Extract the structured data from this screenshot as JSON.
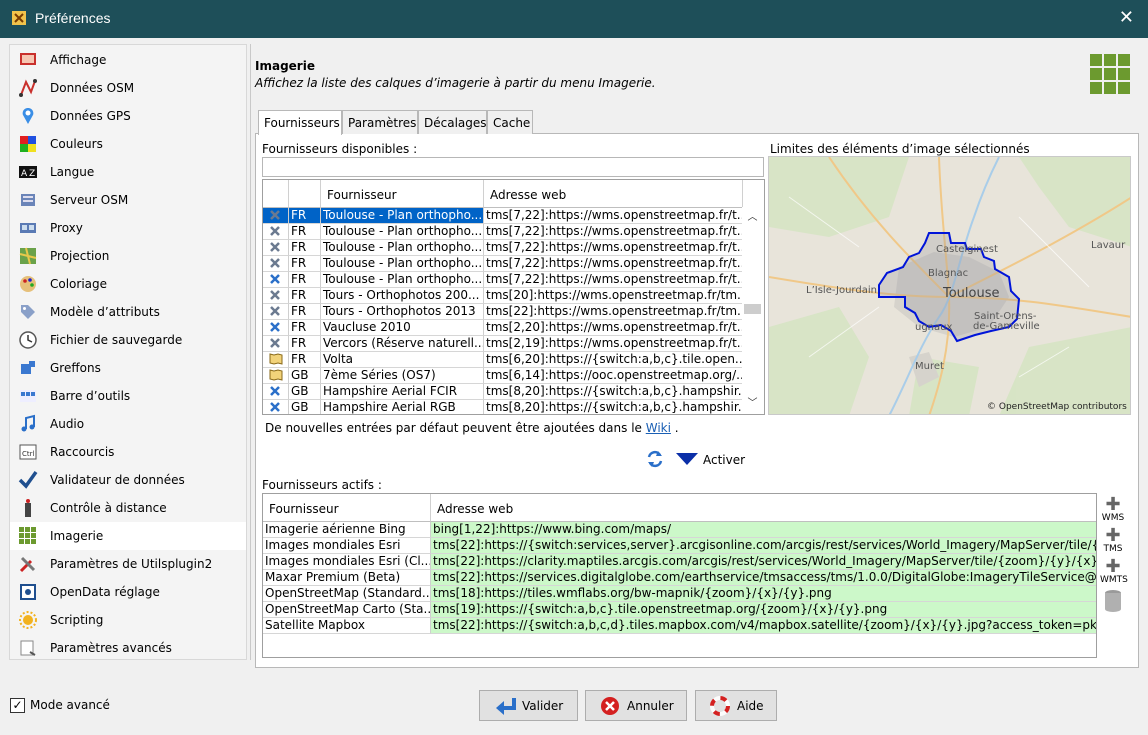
{
  "window": {
    "title": "Préférences",
    "close_label": "✕"
  },
  "sidebar": {
    "items": [
      {
        "label": "Affichage",
        "icon": "display-icon"
      },
      {
        "label": "Données OSM",
        "icon": "osm-data-icon"
      },
      {
        "label": "Données GPS",
        "icon": "gps-pin-icon"
      },
      {
        "label": "Couleurs",
        "icon": "colors-icon"
      },
      {
        "label": "Langue",
        "icon": "language-icon"
      },
      {
        "label": "Serveur OSM",
        "icon": "server-icon"
      },
      {
        "label": "Proxy",
        "icon": "proxy-icon"
      },
      {
        "label": "Projection",
        "icon": "projection-icon"
      },
      {
        "label": "Coloriage",
        "icon": "palette-icon"
      },
      {
        "label": "Modèle d’attributs",
        "icon": "tag-icon"
      },
      {
        "label": "Fichier de sauvegarde",
        "icon": "backup-clock-icon"
      },
      {
        "label": "Greffons",
        "icon": "plugin-icon"
      },
      {
        "label": "Barre d’outils",
        "icon": "toolbar-icon"
      },
      {
        "label": "Audio",
        "icon": "music-note-icon"
      },
      {
        "label": "Raccourcis",
        "icon": "keyboard-shortcut-icon"
      },
      {
        "label": "Validateur de données",
        "icon": "checkmark-icon"
      },
      {
        "label": "Contrôle à distance",
        "icon": "remote-control-icon"
      },
      {
        "label": "Imagerie",
        "icon": "imagery-grid-icon"
      },
      {
        "label": "Paramètres de Utilsplugin2",
        "icon": "tools-icon"
      },
      {
        "label": "OpenData réglage",
        "icon": "opendata-icon"
      },
      {
        "label": "Scripting",
        "icon": "sun-gear-icon"
      },
      {
        "label": "Paramètres avancés",
        "icon": "advanced-settings-icon"
      }
    ],
    "active_index": 17
  },
  "header": {
    "title": "Imagerie",
    "description": "Affichez la liste des calques d’imagerie à partir du menu Imagerie."
  },
  "tabs": [
    {
      "label": "Fournisseurs"
    },
    {
      "label": "Paramètres"
    },
    {
      "label": "Décalages"
    },
    {
      "label": "Cache"
    }
  ],
  "available": {
    "label": "Fournisseurs disponibles :",
    "filter_value": "",
    "headers": {
      "icon": "",
      "country": "",
      "name": "Fournisseur",
      "url": "Adresse web"
    },
    "rows": [
      {
        "icon": "wms-cross-icon",
        "country": "FR",
        "name": "Toulouse - Plan orthopho...",
        "url": "tms[7,22]:https://wms.openstreetmap.fr/t...",
        "selected": true
      },
      {
        "icon": "wms-cross-icon",
        "country": "FR",
        "name": "Toulouse - Plan orthopho...",
        "url": "tms[7,22]:https://wms.openstreetmap.fr/t..."
      },
      {
        "icon": "wms-cross-icon",
        "country": "FR",
        "name": "Toulouse - Plan orthopho...",
        "url": "tms[7,22]:https://wms.openstreetmap.fr/t..."
      },
      {
        "icon": "wms-cross-icon",
        "country": "FR",
        "name": "Toulouse - Plan orthopho...",
        "url": "tms[7,22]:https://wms.openstreetmap.fr/t..."
      },
      {
        "icon": "wms-cross-blue-icon",
        "country": "FR",
        "name": "Toulouse - Plan orthopho...",
        "url": "tms[7,22]:https://wms.openstreetmap.fr/t..."
      },
      {
        "icon": "wms-cross-icon",
        "country": "FR",
        "name": "Tours - Orthophotos 200...",
        "url": "tms[20]:https://wms.openstreetmap.fr/tm..."
      },
      {
        "icon": "wms-cross-icon",
        "country": "FR",
        "name": "Tours - Orthophotos 2013",
        "url": "tms[22]:https://wms.openstreetmap.fr/tm..."
      },
      {
        "icon": "wms-cross-blue-icon",
        "country": "FR",
        "name": "Vaucluse 2010",
        "url": "tms[2,20]:https://wms.openstreetmap.fr/t..."
      },
      {
        "icon": "wms-cross-icon",
        "country": "FR",
        "name": "Vercors (Réserve naturell...",
        "url": "tms[2,19]:https://wms.openstreetmap.fr/t..."
      },
      {
        "icon": "map-book-icon",
        "country": "FR",
        "name": "Volta",
        "url": "tms[6,20]:https://{switch:a,b,c}.tile.open..."
      },
      {
        "icon": "map-book-icon",
        "country": "GB",
        "name": "7ème Séries (OS7)",
        "url": "tms[6,14]:https://ooc.openstreetmap.org/..."
      },
      {
        "icon": "wms-cross-blue-icon",
        "country": "GB",
        "name": "Hampshire Aerial FCIR",
        "url": "tms[8,20]:https://{switch:a,b,c}.hampshir..."
      },
      {
        "icon": "wms-cross-blue-icon",
        "country": "GB",
        "name": "Hampshire Aerial RGB",
        "url": "tms[8,20]:https://{switch:a,b,c}.hampshir..."
      }
    ]
  },
  "wiki_note": {
    "text": "De nouvelles entrées par défaut peuvent être ajoutées dans le",
    "link": "Wiki",
    "suffix": "."
  },
  "map": {
    "label": "Limites des éléments d’image sélectionnés",
    "attribution": "© OpenStreetMap contributors",
    "places": {
      "toulouse": "Toulouse",
      "blagnac": "Blagnac",
      "castelginest": "Castelginest",
      "lisle": "L’Isle-Jourdain",
      "lavaur": "Lavaur",
      "saint_orens": "Saint-Orens-",
      "gameville": "de-Gameville",
      "tournefeuille": "Tournefeuille",
      "lugnaux": "ugnaux",
      "muret": "Muret"
    }
  },
  "activate": {
    "label": "Activer"
  },
  "active": {
    "label": "Fournisseurs actifs :",
    "headers": {
      "name": "Fournisseur",
      "url": "Adresse web"
    },
    "rows": [
      {
        "name": "Imagerie aérienne Bing",
        "url": "bing[1,22]:https://www.bing.com/maps/"
      },
      {
        "name": "Images mondiales Esri",
        "url": "tms[22]:https://{switch:services,server}.arcgisonline.com/arcgis/rest/services/World_Imagery/MapServer/tile/{z..."
      },
      {
        "name": "Images mondiales Esri (Cl...",
        "url": "tms[22]:https://clarity.maptiles.arcgis.com/arcgis/rest/services/World_Imagery/MapServer/tile/{zoom}/{y}/{x}"
      },
      {
        "name": "Maxar Premium (Beta)",
        "url": "tms[22]:https://services.digitalglobe.com/earthservice/tmsaccess/tms/1.0.0/DigitalGlobe:ImageryTileService@EP..."
      },
      {
        "name": "OpenStreetMap (Standard...",
        "url": "tms[18]:https://tiles.wmflabs.org/bw-mapnik/{zoom}/{x}/{y}.png"
      },
      {
        "name": "OpenStreetMap Carto (Sta...",
        "url": "tms[19]:https://{switch:a,b,c}.tile.openstreetmap.org/{zoom}/{x}/{y}.png"
      },
      {
        "name": "Satellite Mapbox",
        "url": "tms[22]:https://{switch:a,b,c,d}.tiles.mapbox.com/v4/mapbox.satellite/{zoom}/{x}/{y}.jpg?access_token=pk.eyJ..."
      }
    ]
  },
  "side_buttons": {
    "wms": "WMS",
    "tms": "TMS",
    "wmts": "WMTS"
  },
  "footer": {
    "advanced_mode": "Mode avancé",
    "advanced_checked": true,
    "ok": "Valider",
    "cancel": "Annuler",
    "help": "Aide"
  }
}
